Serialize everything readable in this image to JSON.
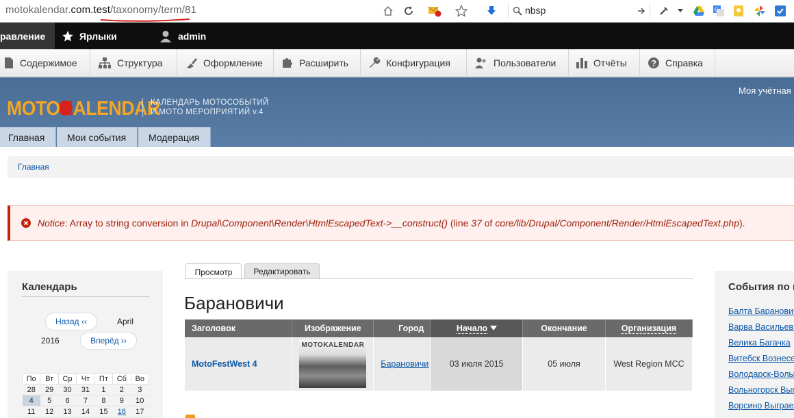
{
  "browser": {
    "url_prefix": "motokalendar.",
    "url_host": "com.test",
    "url_path": "/taxonomy/term/81",
    "search_query": "nbsp",
    "icons": [
      "home-icon",
      "reload-icon",
      "notification-icon",
      "star-icon",
      "download-icon",
      "search-icon",
      "arrow-icon",
      "eyedropper-icon",
      "drive-icon",
      "translate-icon",
      "bulb-icon",
      "pinwheel-icon",
      "extension-icon"
    ]
  },
  "admin_bar": {
    "manage_label": "равление",
    "shortcuts_label": "Ярлыки",
    "user_label": "admin"
  },
  "admin_tray": [
    {
      "label": "Содержимое",
      "icon": "file-icon"
    },
    {
      "label": "Структура",
      "icon": "structure-icon"
    },
    {
      "label": "Оформление",
      "icon": "brush-icon"
    },
    {
      "label": "Расширить",
      "icon": "puzzle-icon"
    },
    {
      "label": "Конфигурация",
      "icon": "wrench-icon"
    },
    {
      "label": "Пользователи",
      "icon": "people-icon"
    },
    {
      "label": "Отчёты",
      "icon": "bar-chart-icon"
    },
    {
      "label": "Справка",
      "icon": "help-icon"
    }
  ],
  "site": {
    "logo_moto": "MOTO",
    "logo_k": "K",
    "logo_rest": "ALENDAR",
    "slogan_line1": "КАЛЕНДАРЬ МОТОСОБЫТИЙ",
    "slogan_line2": "И МОТО МЕРОПРИЯТИЙ v.4",
    "account_link": "Моя учётная з",
    "nav": [
      "Главная",
      "Мои события",
      "Модерация"
    ]
  },
  "breadcrumb": "Главная",
  "notice": {
    "label": "Notice",
    "text1": ": Array to string conversion in ",
    "function": "Drupal\\Component\\Render\\HtmlEscapedText->__construct()",
    "text2": " (line ",
    "line": "37",
    "text3": " of ",
    "file": "core/lib/Drupal/Component/Render/HtmlEscapedText.php",
    "text4": ")."
  },
  "calendar_block": {
    "title": "Календарь",
    "prev_label": "Назад ‹‹",
    "next_label": "Вперёд ››",
    "month": "April",
    "year": "2016",
    "weekdays": [
      "По",
      "Вт",
      "Ср",
      "Чт",
      "Пт",
      "Сб",
      "Во"
    ],
    "weeks": [
      [
        "28",
        "29",
        "30",
        "31",
        "1",
        "2",
        "3"
      ],
      [
        "4",
        "5",
        "6",
        "7",
        "8",
        "9",
        "10"
      ],
      [
        "11",
        "12",
        "13",
        "14",
        "15",
        "16",
        "17"
      ]
    ],
    "today": "4",
    "linked_day": "16"
  },
  "tabs": [
    "Просмотр",
    "Редактировать"
  ],
  "page_title": "Барановичи",
  "events_table": {
    "headers": [
      "Заголовок",
      "Изображение",
      "Город",
      "Начало",
      "Окончание",
      "Организация"
    ],
    "sorted_column": "Начало",
    "rows": [
      {
        "title": "MotoFestWest 4",
        "image_caption": "MOTOKALENDAR",
        "city": "Барановичи",
        "start": "03 июля 2015",
        "end": "05 июля",
        "org": "West Region MCC"
      }
    ]
  },
  "right_block": {
    "title": "События по г",
    "items": [
      "Балта Барановичи",
      "Варва Васильевка",
      "Велика Багачка",
      "Витебск Вознесенск",
      "Володарск-Волынский",
      "Вольногорск Выгреб",
      "Ворсино Выграевка"
    ]
  }
}
